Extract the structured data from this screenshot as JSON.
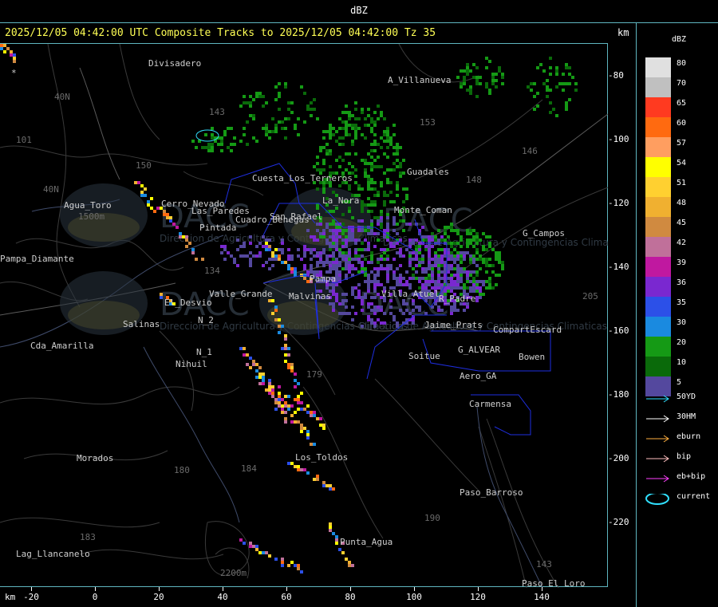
{
  "window": {
    "title": "dBZ"
  },
  "header": {
    "caption": "2025/12/05 04:42:00 UTC Composite Tracks to 2025/12/05 04:42:00 Tz 35",
    "unit": "km"
  },
  "legend": {
    "title": "dBZ",
    "levels": [
      {
        "label": "80",
        "color": "#e0e0e0"
      },
      {
        "label": "70",
        "color": "#c0c0c0"
      },
      {
        "label": "65",
        "color": "#ff3a20"
      },
      {
        "label": "60",
        "color": "#ff6a10"
      },
      {
        "label": "57",
        "color": "#ff9e60"
      },
      {
        "label": "54",
        "color": "#ffff00"
      },
      {
        "label": "51",
        "color": "#ffd030"
      },
      {
        "label": "48",
        "color": "#f0b030"
      },
      {
        "label": "45",
        "color": "#d08a40"
      },
      {
        "label": "42",
        "color": "#c0709a"
      },
      {
        "label": "39",
        "color": "#c018a0"
      },
      {
        "label": "36",
        "color": "#7a28d0"
      },
      {
        "label": "35",
        "color": "#2c50e8"
      },
      {
        "label": "30",
        "color": "#1a8ae0"
      },
      {
        "label": "20",
        "color": "#159a15"
      },
      {
        "label": "10",
        "color": "#0a6a0a"
      },
      {
        "label": "5",
        "color": "#54489e"
      }
    ],
    "tracks": [
      {
        "label": "50YD",
        "color": "#30e0ff",
        "icon": "arrow-icon"
      },
      {
        "label": "30HM",
        "color": "#ffffff",
        "icon": "arrow-icon"
      },
      {
        "label": "eburn",
        "color": "#ffb040",
        "icon": "arrow-icon"
      },
      {
        "label": "bip",
        "color": "#ffc0c0",
        "icon": "arrow-icon"
      },
      {
        "label": "eb+bip",
        "color": "#ff40ff",
        "icon": "arrow-icon"
      },
      {
        "label": "current",
        "color": "#30e0ff",
        "icon": "ellipse-icon"
      }
    ]
  },
  "axes": {
    "x_unit": "km",
    "x_ticks": [
      "-20",
      "0",
      "20",
      "40",
      "60",
      "80",
      "100",
      "120",
      "140"
    ],
    "y_ticks": [
      "-80",
      "-100",
      "-120",
      "-140",
      "-160",
      "-180",
      "-200",
      "-220"
    ]
  },
  "places": [
    "Divisadero",
    "A_Villanueva",
    "Guadales",
    "Agua_Toro",
    "Pampa_Diamante",
    "El_Desvio",
    "Salinas",
    "Cda_Amarilla",
    "Nihuil",
    "N_1",
    "N_2",
    "Valle_Grande",
    "Malvinas",
    "Soitue",
    "Aero_GA",
    "Carmensa",
    "Bowen",
    "CompartEscard",
    "G_ALVEAR",
    "Paso_Barroso",
    "Punta_Agua",
    "Los_Toldos",
    "Morados",
    "Lag_Llancanelo",
    "Paso_El_Loro",
    "G_Campos",
    "San_Rafael",
    "La_Nora",
    "Cuadro_Benegas",
    "Pintada",
    "Las_Paredes",
    "Villa_Atuel",
    "R_Padre",
    "Jaime_Prats",
    "Monte_Coman",
    "Pampa",
    "Cerro_Nevado",
    "Cuesta_Los_Terneros"
  ],
  "elevations": [
    "1500m",
    "2200m",
    "101",
    "40N",
    "40N",
    "143",
    "150",
    "153",
    "146",
    "148",
    "205",
    "184",
    "179",
    "180",
    "183",
    "190",
    "143",
    "134"
  ],
  "watermark": {
    "text": "DACC",
    "sub": "Direccion de Agricultura y Contingencias Climaticas"
  },
  "unprinted": {
    "markers": [
      "*"
    ]
  }
}
